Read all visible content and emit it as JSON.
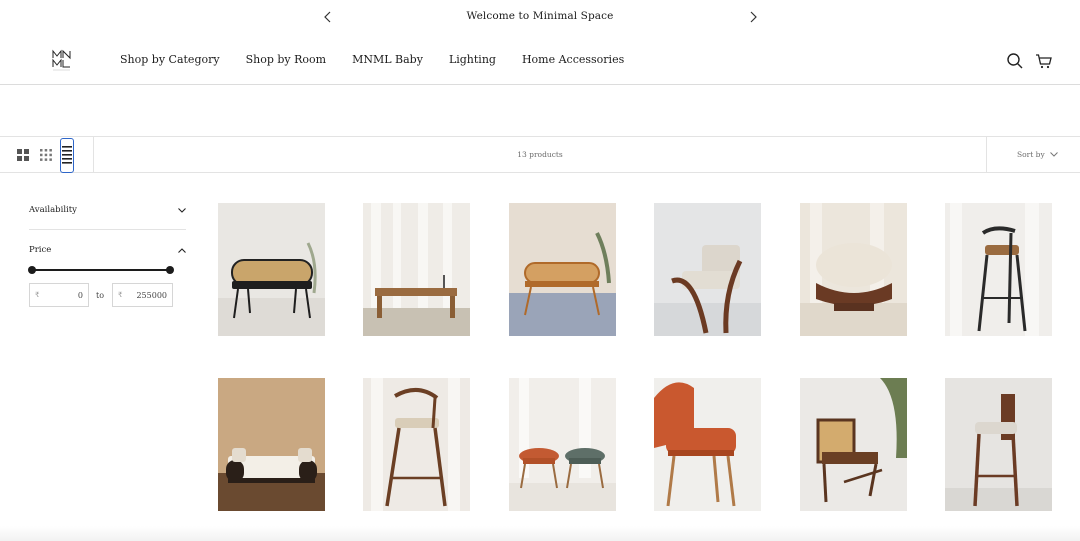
{
  "announcement": {
    "message": "Welcome to Minimal Space"
  },
  "header": {
    "logo_text": "MNML SPACE",
    "nav": [
      {
        "label": "Shop by Category"
      },
      {
        "label": "Shop by Room"
      },
      {
        "label": "MNML Baby"
      },
      {
        "label": "Lighting"
      },
      {
        "label": "Home Accessories"
      }
    ],
    "icons": [
      "search-icon",
      "cart-icon"
    ]
  },
  "toolbar": {
    "view_modes": [
      "grid-large-icon",
      "grid-small-icon",
      "list-icon"
    ],
    "active_view": "list-icon",
    "product_count": "13 products",
    "sort_label": "Sort by"
  },
  "filters": {
    "availability": {
      "label": "Availability",
      "expanded": false
    },
    "price": {
      "label": "Price",
      "expanded": true,
      "currency": "₹",
      "min": "0",
      "max": "255000",
      "to_label": "to"
    }
  },
  "colors": {
    "accent": "#2e66c9",
    "text": "#1c1c1c",
    "border": "#e3e3e3"
  },
  "products": [
    {
      "image": "cane-bench"
    },
    {
      "image": "wooden-bench"
    },
    {
      "image": "cane-back-bench"
    },
    {
      "image": "lounge-chair"
    },
    {
      "image": "round-pouf"
    },
    {
      "image": "black-bar-stool"
    },
    {
      "image": "cane-daybed"
    },
    {
      "image": "wooden-bar-stool"
    },
    {
      "image": "twin-stools"
    },
    {
      "image": "orange-lounger-ottoman"
    },
    {
      "image": "cane-low-chair"
    },
    {
      "image": "tall-bar-chair"
    }
  ]
}
